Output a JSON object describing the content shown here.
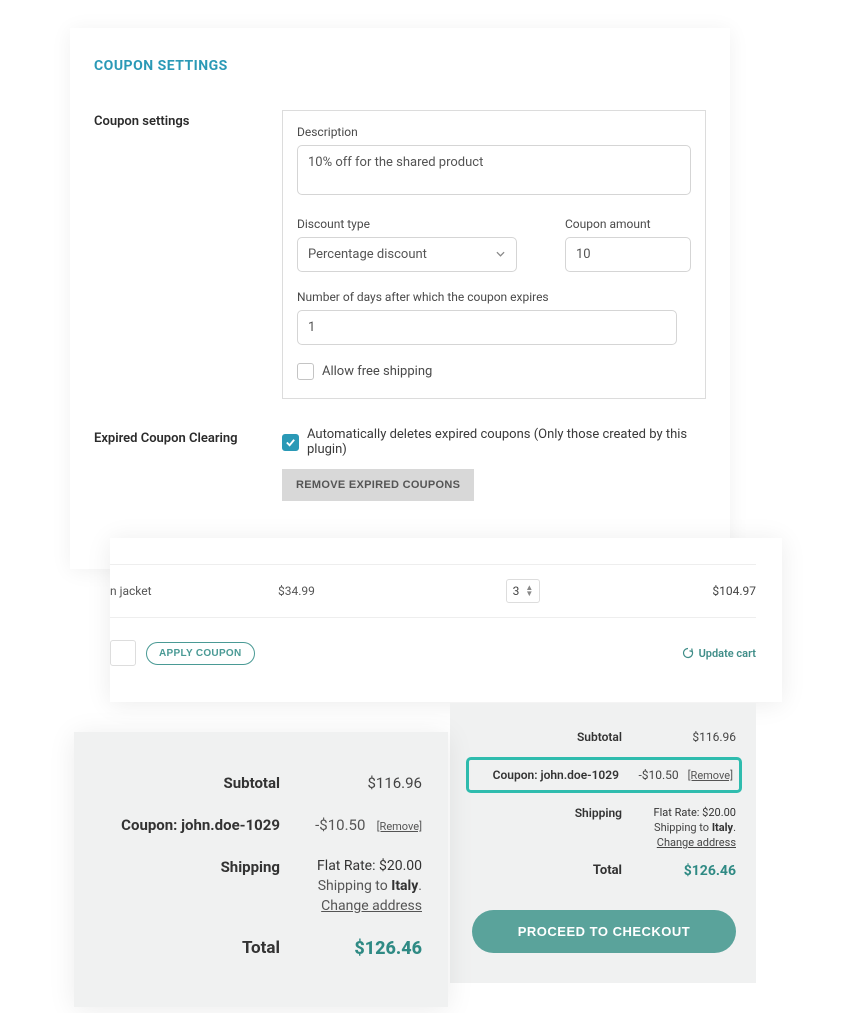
{
  "settings": {
    "title": "COUPON SETTINGS",
    "coupon_settings_label": "Coupon settings",
    "description_label": "Description",
    "description_value": "10% off for the shared product",
    "discount_type_label": "Discount type",
    "discount_type_value": "Percentage discount",
    "coupon_amount_label": "Coupon amount",
    "coupon_amount_value": "10",
    "expiry_label": "Number of days after which the coupon expires",
    "expiry_value": "1",
    "free_shipping_label": "Allow free shipping",
    "expired_clearing_label": "Expired Coupon Clearing",
    "auto_delete_label": "Automatically deletes expired coupons (Only those created by this plugin)",
    "remove_expired_label": "REMOVE EXPIRED COUPONS"
  },
  "cart": {
    "item_name": "n jacket",
    "item_price": "$34.99",
    "item_qty": "3",
    "item_subtotal": "$104.97",
    "update_label": "Update cart",
    "apply_label": "APPLY COUPON",
    "subtotal_label": "Subtotal",
    "subtotal_value": "$116.96",
    "coupon_label": "Coupon: john.doe-1029",
    "coupon_value": "-$10.50",
    "remove_label": "[Remove]",
    "shipping_label": "Shipping",
    "flat_rate": "Flat Rate: $20.00",
    "shipping_to_prefix": "Shipping to ",
    "shipping_to_loc": "Italy",
    "change_address": "Change address",
    "total_label": "Total",
    "total_value": "$126.46",
    "checkout_label": "PROCEED TO CHECKOUT"
  },
  "big_summary": {
    "subtotal_label": "Subtotal",
    "subtotal_value": "$116.96",
    "coupon_label": "Coupon: john.doe-1029",
    "coupon_value": "-$10.50",
    "remove_label": "[Remove]",
    "shipping_label": "Shipping",
    "flat_rate": "Flat Rate: $20.00",
    "shipping_to_prefix": "Shipping to ",
    "shipping_to_loc": "Italy",
    "change_address": "Change address",
    "total_label": "Total",
    "total_value": "$126.46"
  }
}
